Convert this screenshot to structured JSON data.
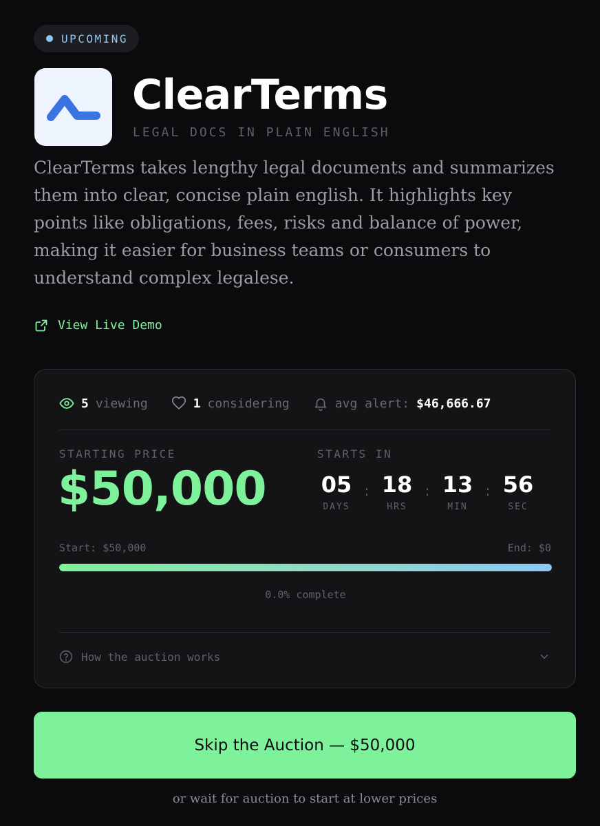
{
  "badge": {
    "label": "UPCOMING"
  },
  "product": {
    "name": "ClearTerms",
    "tagline": "LEGAL DOCS IN PLAIN ENGLISH",
    "description": "ClearTerms takes lengthy legal documents and summarizes them into clear, concise plain english. It highlights key points like obligations, fees, risks and balance of power, making it easier for business teams or consumers to understand complex legalese."
  },
  "demo": {
    "label": "View Live Demo"
  },
  "stats": {
    "viewing_count": "5",
    "viewing_label": "viewing",
    "considering_count": "1",
    "considering_label": "considering",
    "alert_label": "avg alert:",
    "alert_value": "$46,666.67"
  },
  "auction": {
    "price_label": "STARTING PRICE",
    "price": "$50,000",
    "starts_label": "STARTS IN",
    "countdown": [
      {
        "value": "05",
        "unit": "DAYS"
      },
      {
        "value": "18",
        "unit": "HRS"
      },
      {
        "value": "13",
        "unit": "MIN"
      },
      {
        "value": "56",
        "unit": "SEC"
      }
    ],
    "separator": ":",
    "range_start": "Start: $50,000",
    "range_end": "End: $0",
    "progress_label": "0.0% complete",
    "progress_fill": 1.0,
    "how_label": "How the auction works"
  },
  "cta": {
    "label": "Skip the Auction — $50,000"
  },
  "footnote": "or wait for auction to start at lower prices",
  "colors": {
    "accent_green": "#7ef29b",
    "accent_blue": "#8cc8f5",
    "logo_blue": "#3a74e0",
    "background": "#0b0b0d",
    "card": "#141417"
  },
  "icons": {
    "status": "dot-icon",
    "demo": "external-link-icon",
    "viewing": "eye-icon",
    "considering": "heart-icon",
    "alert": "bell-icon",
    "help": "question-circle-icon",
    "expand": "chevron-down-icon"
  }
}
